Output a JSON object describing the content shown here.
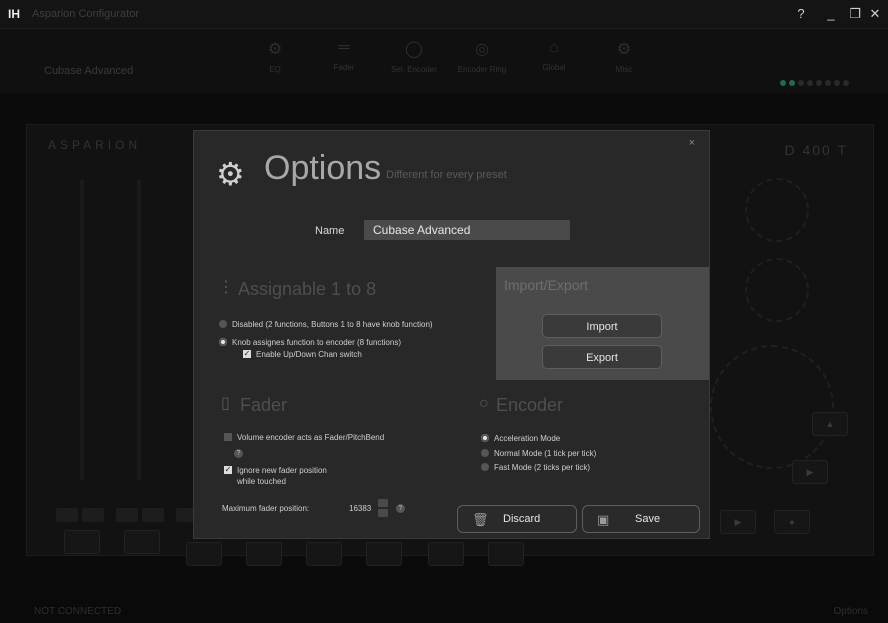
{
  "window": {
    "app_icon": "IH",
    "title": "Asparion Configurator",
    "help": "?",
    "minimize": "_",
    "maximize": "❐",
    "close": "✕"
  },
  "toolbar": {
    "preset": "Cubase Advanced",
    "tools": [
      {
        "label": "EQ",
        "icon": "eq-icon"
      },
      {
        "label": "Fader",
        "icon": "fader-icon"
      },
      {
        "label": "Sel. Encoder",
        "icon": "encoder-icon"
      },
      {
        "label": "Encoder Ring",
        "icon": "encoder-ring-icon"
      },
      {
        "label": "Global",
        "icon": "global-icon"
      },
      {
        "label": "Misc",
        "icon": "misc-icon"
      }
    ]
  },
  "background": {
    "brand": "ASPARION",
    "device": "D 400 T",
    "status_left": "NOT CONNECTED",
    "status_right": "Options"
  },
  "dialog": {
    "title": "Options",
    "subtitle": "Different for every preset",
    "close": "×",
    "name_label": "Name",
    "name_value": "Cubase Advanced",
    "assignable": {
      "title": "Assignable 1 to 8",
      "options": [
        {
          "label": "Disabled (2 functions, Buttons 1 to 8 have knob function)",
          "selected": false
        },
        {
          "label": "Knob assignes function to encoder (8 functions)",
          "selected": true
        }
      ],
      "chan_switch": {
        "label": "Enable Up/Down Chan switch",
        "checked": true
      }
    },
    "import_export": {
      "title": "Import/Export",
      "import": "Import",
      "export": "Export"
    },
    "fader": {
      "title": "Fader",
      "volume_encoder": {
        "label": "Volume encoder acts as Fader/PitchBend",
        "checked": false
      },
      "ignore_touch": {
        "label_line1": "Ignore new fader position",
        "label_line2": "while touched",
        "checked": true
      },
      "max_label": "Maximum fader position:",
      "max_value": "16383",
      "help": "?"
    },
    "encoder": {
      "title": "Encoder",
      "modes": [
        {
          "label": "Acceleration Mode",
          "selected": true
        },
        {
          "label": "Normal Mode (1 tick per tick)",
          "selected": false
        },
        {
          "label": "Fast Mode (2 ticks per tick)",
          "selected": false
        }
      ]
    },
    "actions": {
      "discard": "Discard",
      "save": "Save"
    }
  },
  "colors": {
    "dialog_bg": "#282828",
    "panel_bg": "#4a4a4a",
    "accent_led": "#1b6b55"
  }
}
